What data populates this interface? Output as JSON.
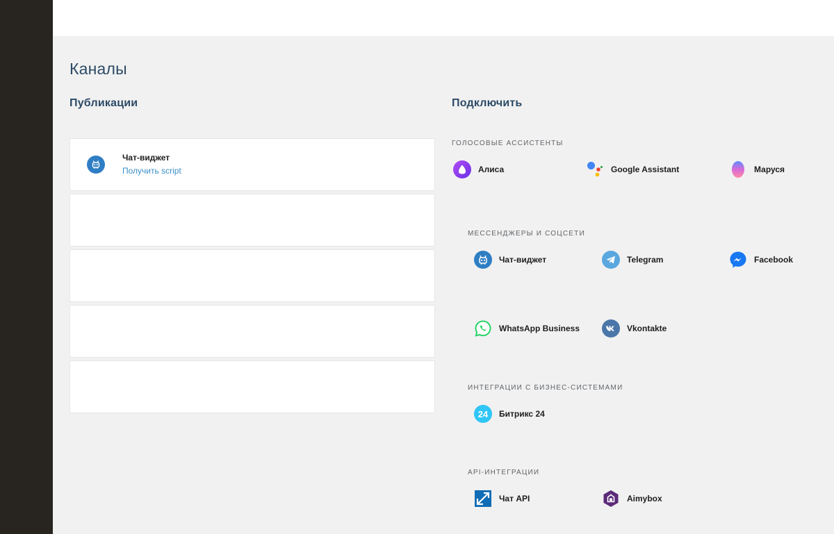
{
  "page": {
    "title": "Каналы"
  },
  "publications": {
    "title": "Публикации",
    "items": [
      {
        "name": "Чат-виджет",
        "link": "Получить script",
        "icon": "robot-icon"
      }
    ],
    "empty_slots": 4
  },
  "connect": {
    "title": "Подключить",
    "categories": [
      {
        "label": "Голосовые ассистенты",
        "items": [
          {
            "label": "Алиса",
            "icon": "alice-icon",
            "color": "#8b3df0"
          },
          {
            "label": "Google Assistant",
            "icon": "google-assistant-icon",
            "color": "#4285f4"
          },
          {
            "label": "Маруся",
            "icon": "marusya-icon",
            "color": "#d96ad8"
          }
        ]
      },
      {
        "label": "Мессенджеры и соцсети",
        "items": [
          {
            "label": "Чат-виджет",
            "icon": "robot-icon",
            "color": "#2f7ec4"
          },
          {
            "label": "Telegram",
            "icon": "telegram-icon",
            "color": "#5aa7e0"
          },
          {
            "label": "Facebook",
            "icon": "messenger-icon",
            "color": "#1877f2"
          },
          {
            "label": "WhatsApp Business",
            "icon": "whatsapp-icon",
            "color": "#25d366"
          },
          {
            "label": "Vkontakte",
            "icon": "vk-icon",
            "color": "#4a76a8"
          }
        ]
      },
      {
        "label": "Интеграции с бизнес-системами",
        "items": [
          {
            "label": "Битрикс 24",
            "icon": "bitrix24-icon",
            "icon_text": "24",
            "color": "#2fc6f6"
          }
        ]
      },
      {
        "label": "API-интеграции",
        "items": [
          {
            "label": "Чат API",
            "icon": "chat-api-icon",
            "color": "#0f6cb6"
          },
          {
            "label": "Aimybox",
            "icon": "aimybox-icon",
            "color": "#5b2a78"
          }
        ]
      }
    ]
  }
}
